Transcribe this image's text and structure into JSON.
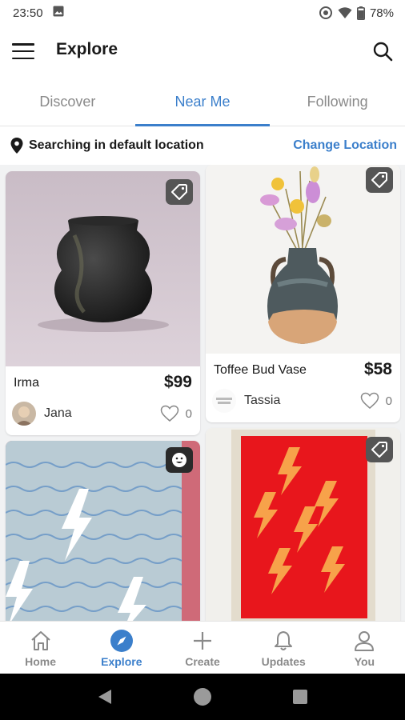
{
  "status_bar": {
    "time": "23:50",
    "battery": "78%"
  },
  "app_bar": {
    "title": "Explore"
  },
  "tabs": [
    {
      "label": "Discover",
      "active": false
    },
    {
      "label": "Near Me",
      "active": true
    },
    {
      "label": "Following",
      "active": false
    }
  ],
  "location": {
    "text": "Searching in default location",
    "action": "Change Location"
  },
  "cards": [
    {
      "title": "Irma",
      "price": "$99",
      "seller": "Jana",
      "likes": "0",
      "badge_icon": "tag-icon"
    },
    {
      "title": "Toffee Bud Vase",
      "price": "$58",
      "seller": "Tassia",
      "likes": "0",
      "badge_icon": "tag-icon"
    },
    {
      "badge_icon": "smiley-icon"
    },
    {
      "badge_icon": "tag-icon"
    }
  ],
  "bottom_nav": [
    {
      "label": "Home",
      "icon": "home-icon",
      "active": false
    },
    {
      "label": "Explore",
      "icon": "compass-icon",
      "active": true
    },
    {
      "label": "Create",
      "icon": "plus-icon",
      "active": false
    },
    {
      "label": "Updates",
      "icon": "bell-icon",
      "active": false
    },
    {
      "label": "You",
      "icon": "person-icon",
      "active": false
    }
  ],
  "colors": {
    "accent": "#3b7fcb",
    "inactive": "#8a8a8a",
    "text": "#1a1a1a"
  }
}
